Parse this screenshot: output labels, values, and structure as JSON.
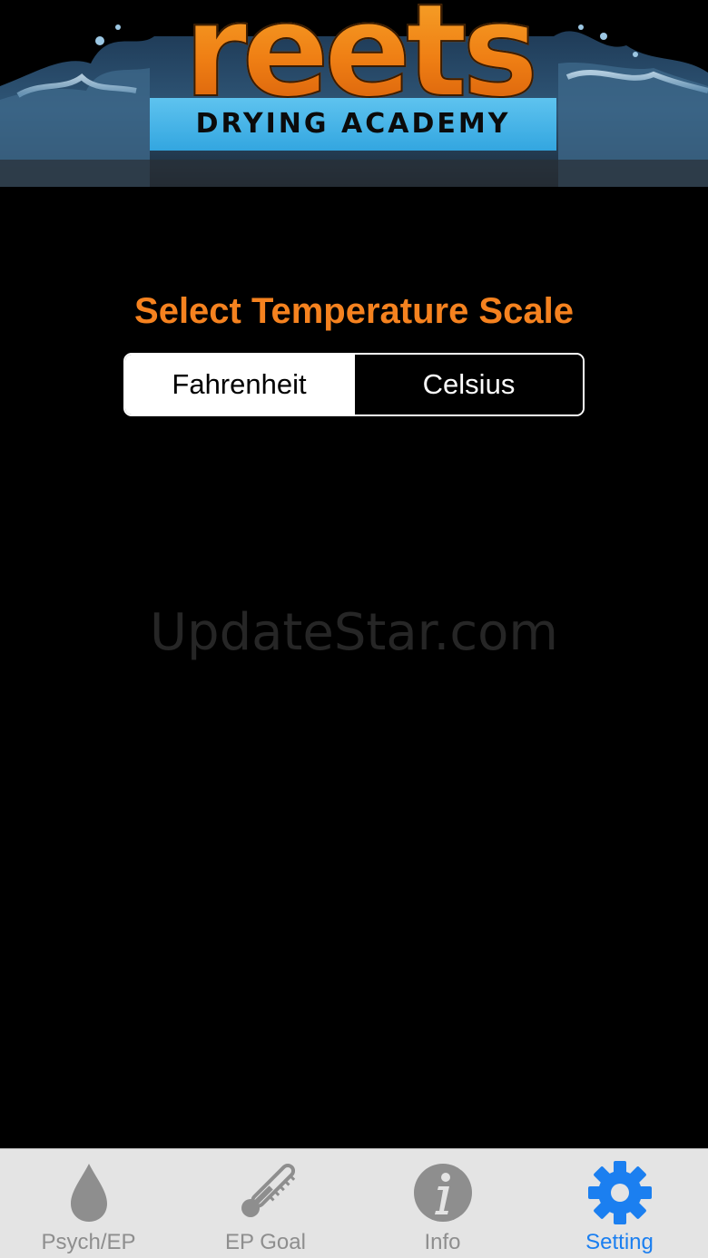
{
  "header": {
    "logo_word": "reets",
    "logo_tagline": "DRYING ACADEMY"
  },
  "settings": {
    "title": "Select Temperature Scale",
    "scale_options": [
      "Fahrenheit",
      "Celsius"
    ],
    "selected_scale": "Fahrenheit"
  },
  "watermark": "UpdateStar.com",
  "tabbar": {
    "tabs": [
      {
        "label": "Psych/EP",
        "icon": "water-drop-icon",
        "active": false
      },
      {
        "label": "EP Goal",
        "icon": "thermometer-icon",
        "active": false
      },
      {
        "label": "Info",
        "icon": "info-icon",
        "active": false
      },
      {
        "label": "Setting",
        "icon": "gear-icon",
        "active": true
      }
    ]
  },
  "colors": {
    "accent_orange": "#f5821f",
    "active_tab_blue": "#1b7ff0",
    "inactive_tab_gray": "#8e8e8e",
    "tabbar_background": "#e4e4e4",
    "logo_plate_blue": "#33a6e0"
  }
}
